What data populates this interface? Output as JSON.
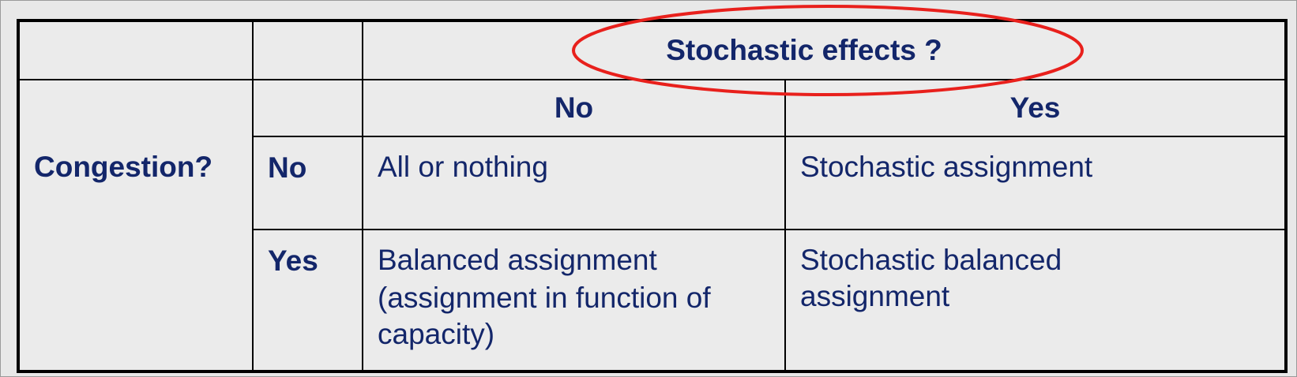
{
  "table": {
    "header_stochastic": "Stochastic effects ?",
    "header_no": "No",
    "header_yes": "Yes",
    "row_label": "Congestion?",
    "row_no": "No",
    "row_yes": "Yes",
    "cell_no_no": "All or nothing",
    "cell_no_yes": "Stochastic assignment",
    "cell_yes_no_line1": "Balanced assignment",
    "cell_yes_no_line2": "(assignment in function of",
    "cell_yes_no_line3": "capacity)",
    "cell_yes_yes_line1": "Stochastic balanced",
    "cell_yes_yes_line2": "assignment"
  },
  "colors": {
    "text": "#13266a",
    "highlight_ellipse": "#e8201c",
    "background": "#e8e8e8",
    "border": "#000000"
  }
}
